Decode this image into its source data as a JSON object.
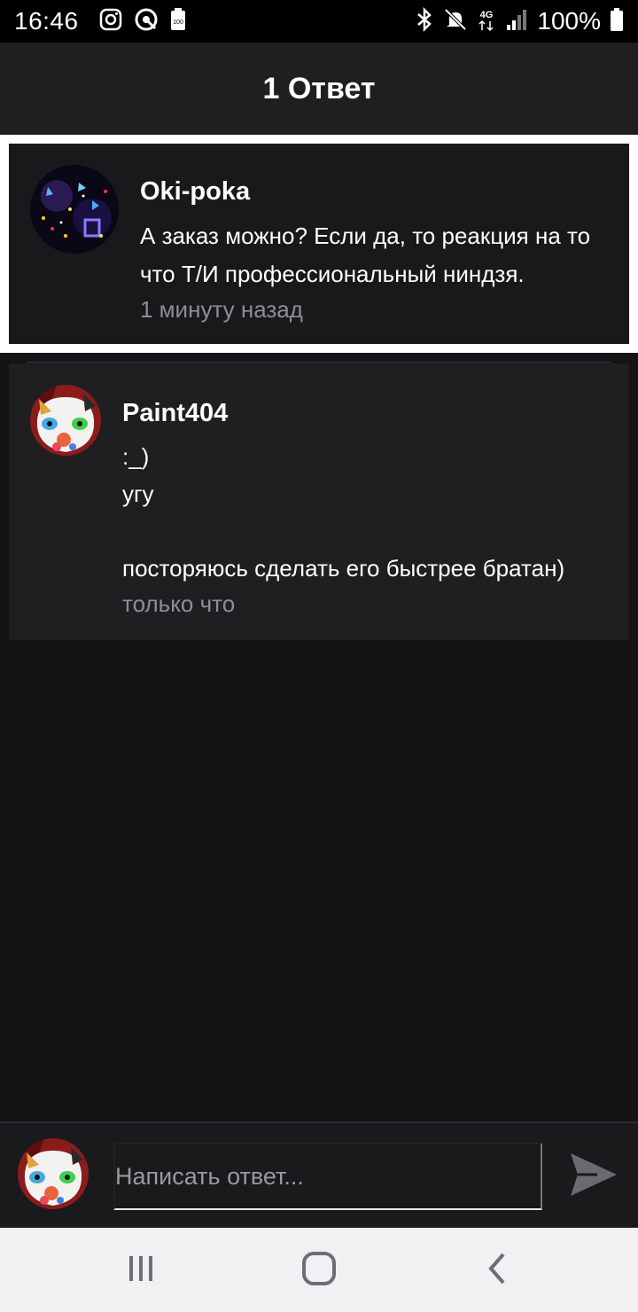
{
  "status_bar": {
    "time": "16:46",
    "battery_percent": "100%",
    "icons_left": [
      "instagram-icon",
      "target-icon",
      "battery-saver-icon"
    ],
    "icons_right": [
      "bluetooth-icon",
      "mute-icon",
      "lte-signal-icon",
      "signal-bars-icon",
      "battery-icon"
    ]
  },
  "header": {
    "title": "1 Ответ"
  },
  "parent_comment": {
    "author": "Oki-poka",
    "text": "А заказ можно? Если да, то реакция на то что Т/И профессиональный ниндзя.",
    "time": "1 минуту назад"
  },
  "reply": {
    "author": "Paint404",
    "lines": [
      ":_)",
      "угу",
      "",
      "посторяюсь сделать его быстрее братан)"
    ],
    "time": "только что"
  },
  "compose": {
    "placeholder": "Написать ответ..."
  },
  "nav": [
    "recent-apps-icon",
    "home-icon",
    "back-icon"
  ],
  "colors": {
    "background": "#141316",
    "header": "#1f1e21",
    "card": "#19181b",
    "muted_text": "#8f8e93"
  }
}
